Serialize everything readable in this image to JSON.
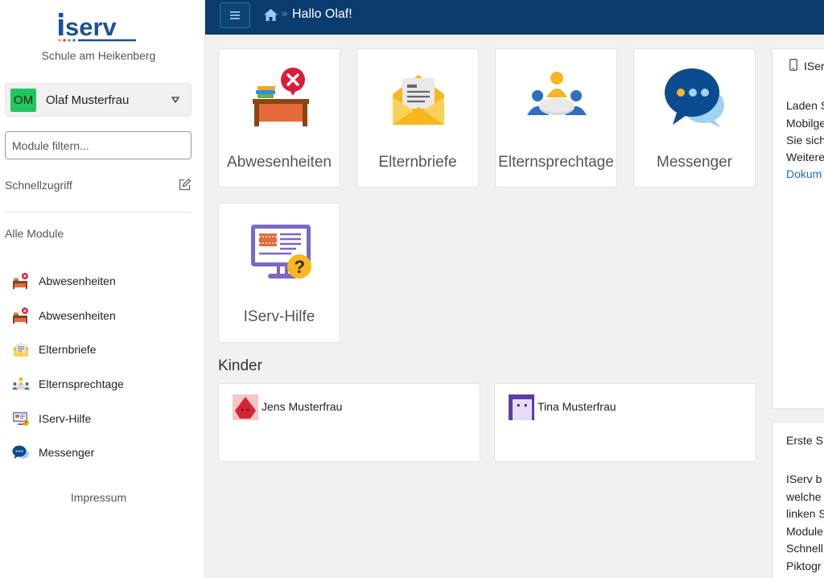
{
  "sidebar": {
    "school": "Schule am Heikenberg",
    "user": {
      "initials": "OM",
      "name": "Olaf Musterfrau"
    },
    "filter_placeholder": "Module filtern...",
    "quick_access": "Schnellzugriff",
    "all_modules": "Alle Module",
    "modules": [
      {
        "label": "Abwesenheiten",
        "icon": "absence-desk-icon"
      },
      {
        "label": "Abwesenheiten",
        "icon": "absence-desk-icon"
      },
      {
        "label": "Elternbriefe",
        "icon": "letter-envelope-icon"
      },
      {
        "label": "Elternsprechtage",
        "icon": "meeting-table-icon"
      },
      {
        "label": "IServ-Hilfe",
        "icon": "help-monitor-icon"
      },
      {
        "label": "Messenger",
        "icon": "chat-bubbles-icon"
      }
    ],
    "impressum": "Impressum"
  },
  "topbar": {
    "separator": "»",
    "greeting": "Hallo Olaf!"
  },
  "tiles": [
    {
      "label": "Abwesenheiten",
      "icon": "absence-desk-icon"
    },
    {
      "label": "Elternbriefe",
      "icon": "letter-envelope-icon"
    },
    {
      "label": "Elternsprechtage",
      "icon": "meeting-table-icon"
    },
    {
      "label": "Messenger",
      "icon": "chat-bubbles-icon"
    },
    {
      "label": "IServ-Hilfe",
      "icon": "help-monitor-icon"
    }
  ],
  "kinder": {
    "heading": "Kinder",
    "children": [
      {
        "name": "Jens Musterfrau",
        "avatar_color": "#e03a4a"
      },
      {
        "name": "Tina Musterfrau",
        "avatar_color": "#5b3fa8"
      }
    ]
  },
  "panels": {
    "app": {
      "title": "ISer",
      "lines": [
        "Laden S",
        "Mobilge",
        "Sie sich",
        "Weitere"
      ],
      "link": "Dokum"
    },
    "first_steps": {
      "title": "Erste S",
      "lines": [
        "IServ b",
        "welche",
        "linken S",
        "Module",
        "Schnell",
        "Piktogr"
      ]
    }
  },
  "colors": {
    "topbar": "#0a3d6e",
    "brand": "#1b4f9a",
    "link": "#1a6ec2",
    "avatar": "#22c55e"
  }
}
